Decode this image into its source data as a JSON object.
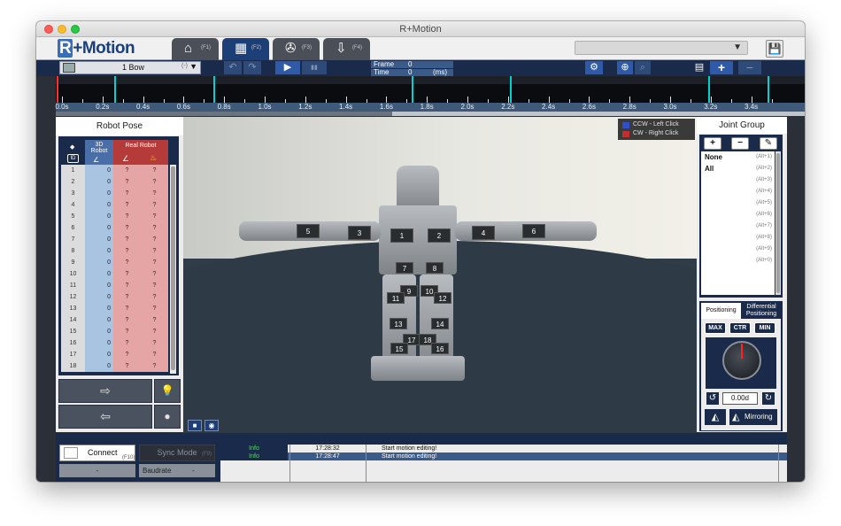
{
  "window": {
    "title": "R+Motion"
  },
  "app": {
    "logo_prefix": "R",
    "logo_suffix": "+Motion",
    "tabs": [
      {
        "key": "(F1)",
        "icon": "⌂"
      },
      {
        "key": "(F2)",
        "icon": "▦"
      },
      {
        "key": "(F3)",
        "icon": "✇"
      },
      {
        "key": "(F4)",
        "icon": "⇩"
      }
    ],
    "dropdown_arrow": "▼",
    "save_icon": "💾"
  },
  "toolbar": {
    "motion_name": "1 Bow",
    "motion_extra": "(-)",
    "motion_arrow": "▼",
    "undo_icon": "↶",
    "redo_icon": "↷",
    "play_icon": "▶",
    "pause_icon": "▮▮",
    "frame_label": "Frame",
    "frame_value": "0",
    "time_label": "Time",
    "time_value": "0",
    "time_unit": "(ms)",
    "settings_icon": "⚙",
    "zoom_in_icon": "⊕",
    "zoom_out_icon": "⌕",
    "copy_icon": "▤",
    "add_icon": "+",
    "remove_icon": "−"
  },
  "timeline": {
    "labels": [
      "0.0s",
      "0.2s",
      "0.4s",
      "0.6s",
      "0.8s",
      "1.0s",
      "1.2s",
      "1.4s",
      "1.6s",
      "1.8s",
      "2.0s",
      "2.2s",
      "2.4s",
      "2.6s",
      "2.8s",
      "3.0s",
      "3.2s",
      "3.4s"
    ]
  },
  "robot_pose": {
    "title": "Robot Pose",
    "id_icon": "◆",
    "id_badge": "ID",
    "col_3d": "3D Robot",
    "col_real": "Real Robot",
    "rows": [
      {
        "id": "1",
        "v": "0",
        "r1": "?",
        "r2": "?"
      },
      {
        "id": "2",
        "v": "0",
        "r1": "?",
        "r2": "?"
      },
      {
        "id": "3",
        "v": "0",
        "r1": "?",
        "r2": "?"
      },
      {
        "id": "4",
        "v": "0",
        "r1": "?",
        "r2": "?"
      },
      {
        "id": "5",
        "v": "0",
        "r1": "?",
        "r2": "?"
      },
      {
        "id": "6",
        "v": "0",
        "r1": "?",
        "r2": "?"
      },
      {
        "id": "7",
        "v": "0",
        "r1": "?",
        "r2": "?"
      },
      {
        "id": "8",
        "v": "0",
        "r1": "?",
        "r2": "?"
      },
      {
        "id": "9",
        "v": "0",
        "r1": "?",
        "r2": "?"
      },
      {
        "id": "10",
        "v": "0",
        "r1": "?",
        "r2": "?"
      },
      {
        "id": "11",
        "v": "0",
        "r1": "?",
        "r2": "?"
      },
      {
        "id": "12",
        "v": "0",
        "r1": "?",
        "r2": "?"
      },
      {
        "id": "13",
        "v": "0",
        "r1": "?",
        "r2": "?"
      },
      {
        "id": "14",
        "v": "0",
        "r1": "?",
        "r2": "?"
      },
      {
        "id": "15",
        "v": "0",
        "r1": "?",
        "r2": "?"
      },
      {
        "id": "16",
        "v": "0",
        "r1": "?",
        "r2": "?"
      },
      {
        "id": "17",
        "v": "0",
        "r1": "?",
        "r2": "?"
      },
      {
        "id": "18",
        "v": "0",
        "r1": "?",
        "r2": "?"
      }
    ],
    "btn_to_real": "⇨",
    "btn_to_3d": "⇦",
    "btn_light_on": "💡",
    "btn_light_off": "●"
  },
  "viewport": {
    "legend_ccw": "CCW  - Left Click",
    "legend_cw": "CW   - Right Click",
    "colors": {
      "ccw": "#3050c8",
      "cw": "#c03030"
    },
    "servos": [
      "1",
      "2",
      "3",
      "4",
      "5",
      "6",
      "7",
      "8",
      "9",
      "10",
      "11",
      "12",
      "13",
      "14",
      "15",
      "16",
      "17",
      "18"
    ],
    "cam_icon": "■",
    "reset_icon": "◉"
  },
  "joint_group": {
    "title": "Joint Group",
    "add_icon": "+",
    "remove_icon": "−",
    "edit_icon": "✎",
    "items": [
      {
        "name": "None",
        "alt": "(Alt+1)"
      },
      {
        "name": "All",
        "alt": "(Alt+2)"
      },
      {
        "name": "",
        "alt": "(Alt+3)"
      },
      {
        "name": "",
        "alt": "(Alt+4)"
      },
      {
        "name": "",
        "alt": "(Alt+5)"
      },
      {
        "name": "",
        "alt": "(Alt+6)"
      },
      {
        "name": "",
        "alt": "(Alt+7)"
      },
      {
        "name": "",
        "alt": "(Alt+8)"
      },
      {
        "name": "",
        "alt": "(Alt+9)"
      },
      {
        "name": "",
        "alt": "(Alt+0)"
      }
    ]
  },
  "positioning": {
    "tab_positioning": "Positioning",
    "tab_diff_1": "Differential",
    "tab_diff_2": "Positioning",
    "max": "MAX",
    "ctr": "CTR",
    "min": "MIN",
    "value": "0.00d",
    "ccw_icon": "↺",
    "cw_icon": "↻",
    "mirror_icon": "◭",
    "mirroring": "Mirroring"
  },
  "status": {
    "connect": "Connect",
    "connect_key": "(F10)",
    "sync_mode": "Sync Mode",
    "sync_key": "(F9)",
    "port_value": "-",
    "baudrate_label": "Baudrate",
    "baudrate_value": "-",
    "log": [
      {
        "level": "Info",
        "time": "17:28:32",
        "msg": "Start motion editing!"
      },
      {
        "level": "Info",
        "time": "17:28:47",
        "msg": "Start motion editing!"
      }
    ]
  }
}
